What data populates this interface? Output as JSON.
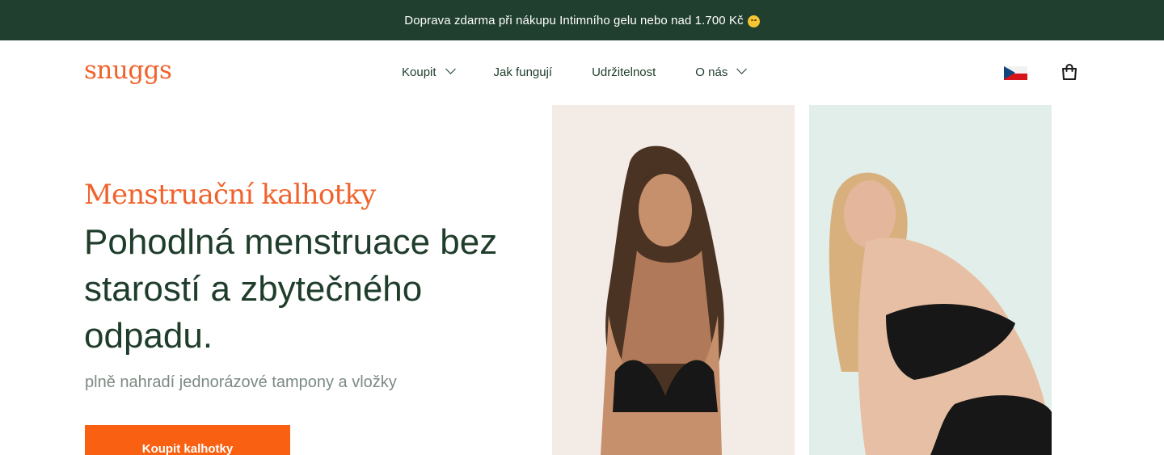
{
  "promo": {
    "text": "Doprava zdarma při nákupu Intimního gelu nebo nad 1.700 Kč"
  },
  "header": {
    "logo": "snuggs",
    "nav": [
      {
        "label": "Koupit",
        "has_dropdown": true
      },
      {
        "label": "Jak fungují",
        "has_dropdown": false
      },
      {
        "label": "Udržitelnost",
        "has_dropdown": false
      },
      {
        "label": "O nás",
        "has_dropdown": true
      }
    ],
    "language_flag": "czech-flag-icon",
    "cart_icon": "shopping-bag-icon"
  },
  "hero": {
    "subtitle": "Menstruační kalhotky",
    "title": "Pohodlná menstruace bez starostí a zbytečného odpadu.",
    "description": "plně nahradí jednorázové tampony a vložky",
    "cta_label": "Koupit kalhotky"
  },
  "colors": {
    "promo_bg": "#213f2f",
    "brand_orange": "#f0622c",
    "cta_orange": "#fa6011",
    "heading_green": "#1f3d2b",
    "muted_text": "#7c8a82",
    "photo_left_bg": "#f3ebe6",
    "photo_right_bg": "#e2eeea"
  }
}
